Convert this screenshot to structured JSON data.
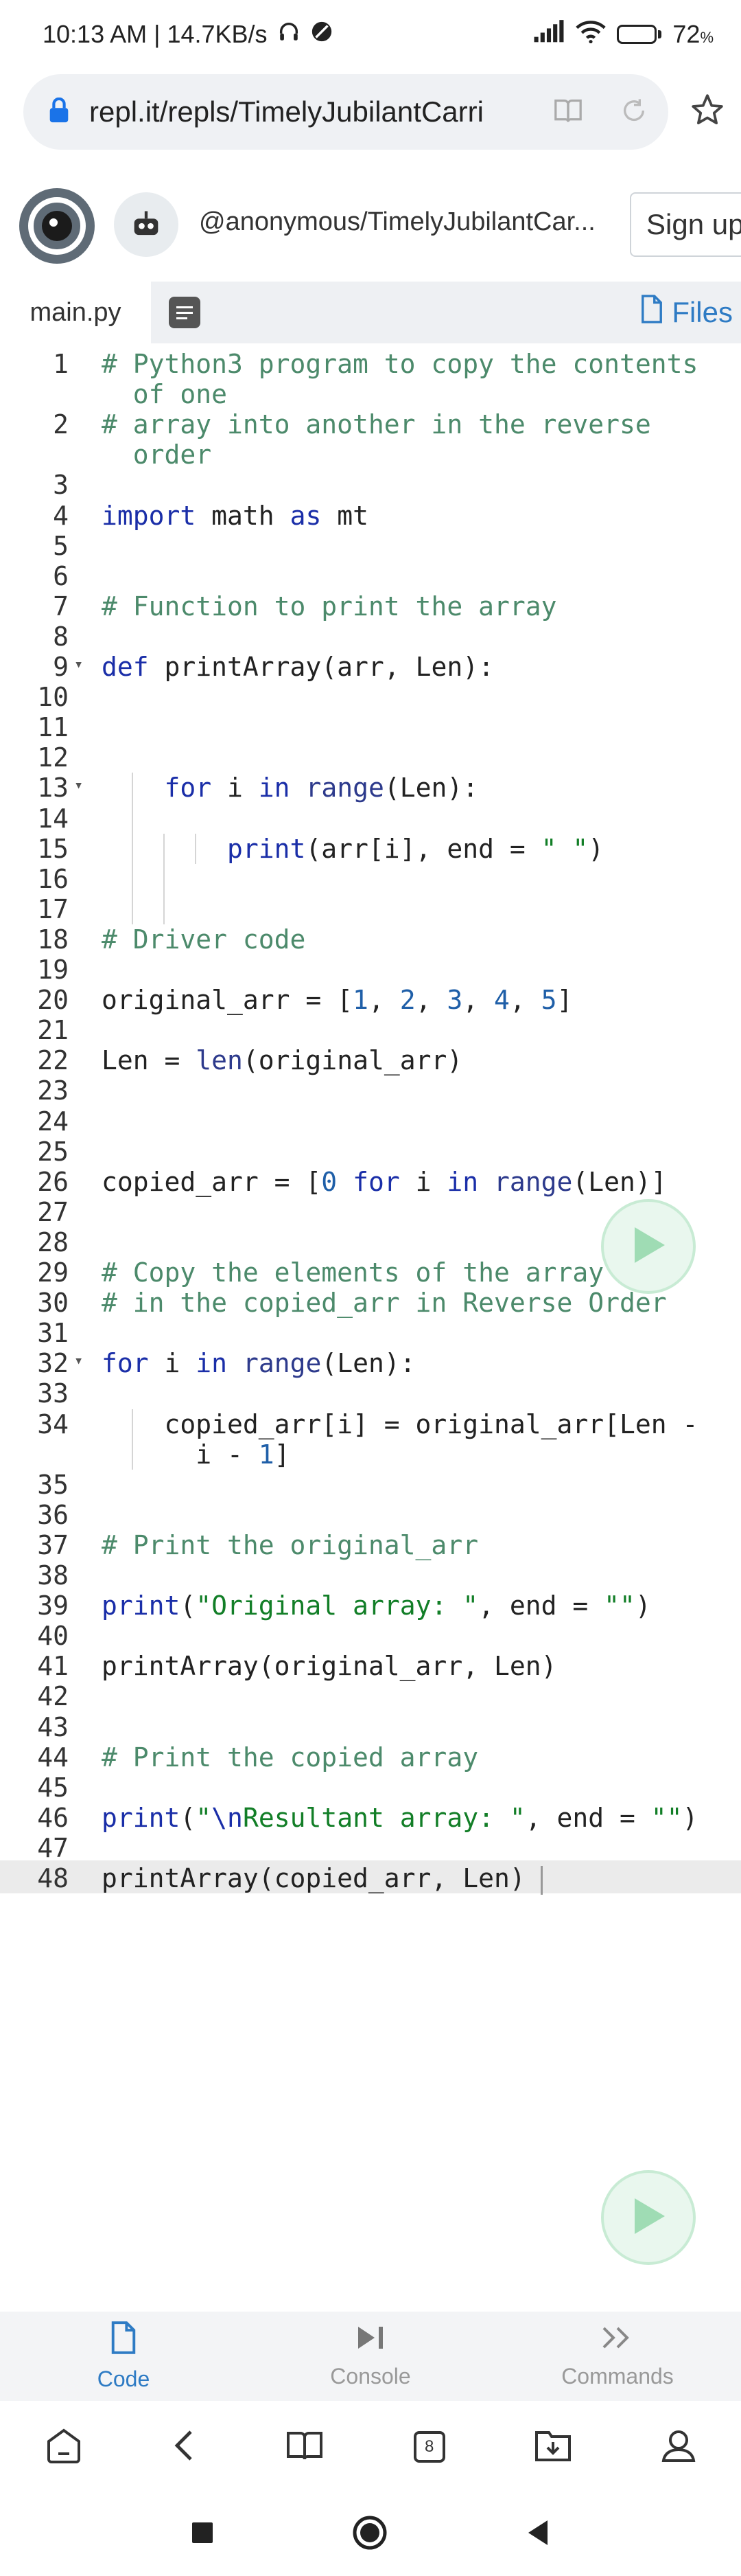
{
  "status": {
    "time_speed": "10:13 AM | 14.7KB/s",
    "battery": "72",
    "battery_level": 0.72
  },
  "browser": {
    "url": "repl.it/repls/TimelyJubilantCarri"
  },
  "repl": {
    "name": "@anonymous/TimelyJubilantCar...",
    "signup_label": "Sign up"
  },
  "tabs": {
    "file": "main.py",
    "files_label": "Files"
  },
  "code_lines": [
    {
      "n": "1",
      "t": "# Python3 program to copy the contents"
    },
    {
      "n": "",
      "t": "  of one"
    },
    {
      "n": "2",
      "t": "# array into another in the reverse"
    },
    {
      "n": "",
      "t": "  order"
    },
    {
      "n": "3",
      "t": ""
    },
    {
      "n": "4",
      "t": "import math as mt"
    },
    {
      "n": "5",
      "t": ""
    },
    {
      "n": "6",
      "t": ""
    },
    {
      "n": "7",
      "t": "# Function to print the array"
    },
    {
      "n": "8",
      "t": ""
    },
    {
      "n": "9",
      "t": "def printArray(arr, Len):"
    },
    {
      "n": "10",
      "t": ""
    },
    {
      "n": "11",
      "t": ""
    },
    {
      "n": "12",
      "t": ""
    },
    {
      "n": "13",
      "t": "    for i in range(Len):"
    },
    {
      "n": "14",
      "t": ""
    },
    {
      "n": "15",
      "t": "        print(arr[i], end = \" \")"
    },
    {
      "n": "16",
      "t": ""
    },
    {
      "n": "17",
      "t": ""
    },
    {
      "n": "18",
      "t": "# Driver code"
    },
    {
      "n": "19",
      "t": ""
    },
    {
      "n": "20",
      "t": "original_arr = [1, 2, 3, 4, 5]"
    },
    {
      "n": "21",
      "t": ""
    },
    {
      "n": "22",
      "t": "Len = len(original_arr)"
    },
    {
      "n": "23",
      "t": ""
    },
    {
      "n": "24",
      "t": ""
    },
    {
      "n": "25",
      "t": ""
    },
    {
      "n": "26",
      "t": "copied_arr = [0 for i in range(Len)]"
    },
    {
      "n": "27",
      "t": ""
    },
    {
      "n": "28",
      "t": ""
    },
    {
      "n": "29",
      "t": "# Copy the elements of the array"
    },
    {
      "n": "30",
      "t": "# in the copied_arr in Reverse Order"
    },
    {
      "n": "31",
      "t": ""
    },
    {
      "n": "32",
      "t": "for i in range(Len):"
    },
    {
      "n": "33",
      "t": ""
    },
    {
      "n": "34",
      "t": "    copied_arr[i] = original_arr[Len -"
    },
    {
      "n": "",
      "t": "      i - 1]"
    },
    {
      "n": "35",
      "t": ""
    },
    {
      "n": "36",
      "t": ""
    },
    {
      "n": "37",
      "t": "# Print the original_arr"
    },
    {
      "n": "38",
      "t": ""
    },
    {
      "n": "39",
      "t": "print(\"Original array: \", end = \"\")"
    },
    {
      "n": "40",
      "t": ""
    },
    {
      "n": "41",
      "t": "printArray(original_arr, Len)"
    },
    {
      "n": "42",
      "t": ""
    },
    {
      "n": "43",
      "t": ""
    },
    {
      "n": "44",
      "t": "# Print the copied array"
    },
    {
      "n": "45",
      "t": ""
    },
    {
      "n": "46",
      "t": "print(\"\\nResultant array: \", end = \"\")"
    },
    {
      "n": "47",
      "t": ""
    },
    {
      "n": "48",
      "t": "printArray(copied_arr, Len)"
    }
  ],
  "bottom_nav": {
    "code": "Code",
    "console": "Console",
    "commands": "Commands"
  },
  "browser_toolbar": {
    "tab_count": "8"
  },
  "colors": {
    "accent": "#2e7bc4",
    "comment": "#4c8a6b",
    "keyword": "#1a2ea8",
    "string": "#127e27",
    "run_green": "#9fdcb4"
  }
}
